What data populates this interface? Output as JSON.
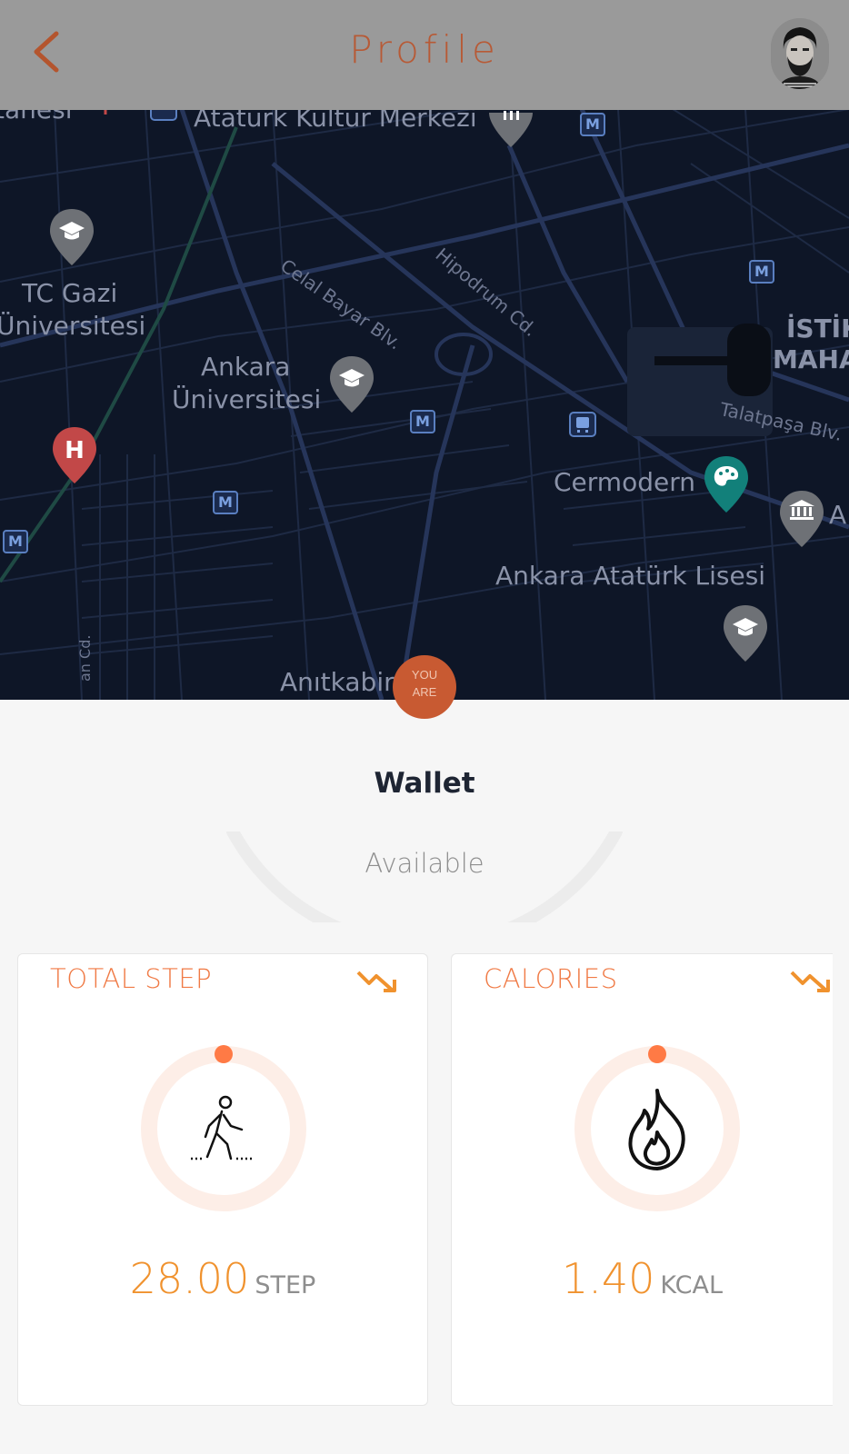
{
  "header": {
    "title": "Profile",
    "back_icon": "chevron-left-icon",
    "avatar_icon": "user-avatar",
    "background": "#9a9a9a",
    "title_color": "#b75a36"
  },
  "map": {
    "labels": {
      "ataturk_kultur": "Atatürk Kültür Merkezi",
      "tc_gazi_1": "TC Gazi",
      "tc_gazi_2": "Üniversitesi",
      "ankara_uni_1": "Ankara",
      "ankara_uni_2": "Üniversitesi",
      "istik_1": "İSTİK",
      "istik_2": "MAHA",
      "cermodern": "Cermodern",
      "ataturk_lisesi": "Ankara Atatürk Lisesi",
      "anitkabir": "Anıtkabir",
      "partial_top": "tanesi",
      "partial_right": "A"
    },
    "roads": {
      "celal_bayar": "Celal Bayar Blv.",
      "hipodrum": "Hipodrum Cd.",
      "talatpasa": "Talatpaşa Blv.",
      "side_road": "an Cd."
    },
    "metro_label": "M",
    "hospital_label": "H",
    "you_are": [
      "YOU",
      "ARE"
    ],
    "background": "#0e1627"
  },
  "wallet": {
    "title": "Wallet",
    "available_label": "Available"
  },
  "cards": {
    "steps": {
      "title": "TOTAL STEP",
      "value": "28.00",
      "unit": "STEP",
      "icon": "walking-person-icon",
      "trend_icon": "trend-down-icon"
    },
    "calories": {
      "title": "CALORIES",
      "value": "1.40",
      "unit": "KCAL",
      "icon": "flame-icon",
      "trend_icon": "trend-down-icon"
    }
  },
  "colors": {
    "accent": "#f07a45",
    "value": "#f0922e",
    "ring": "#fdeee7",
    "ring_dot": "#ff7a45"
  }
}
